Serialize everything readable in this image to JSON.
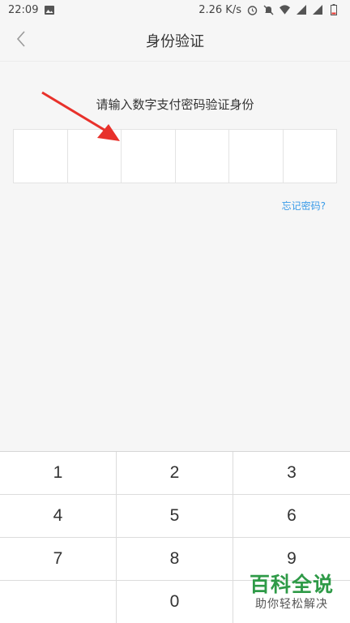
{
  "status_bar": {
    "time": "22:09",
    "speed": "2.26 K/s",
    "icons": [
      "image-icon",
      "alarm-icon",
      "mute-icon",
      "wifi-icon",
      "signal-icon",
      "signal-icon",
      "battery-icon"
    ]
  },
  "header": {
    "title": "身份验证",
    "back_icon": "chevron-left-icon"
  },
  "main": {
    "prompt": "请输入数字支付密码验证身份",
    "pin_length": 6,
    "forgot_link": "忘记密码?"
  },
  "keypad": {
    "keys": [
      "1",
      "2",
      "3",
      "4",
      "5",
      "6",
      "7",
      "8",
      "9",
      "",
      "0",
      ""
    ]
  },
  "watermark": {
    "title": "百科全说",
    "subtitle": "助你轻松解决"
  },
  "colors": {
    "accent_link": "#3a9be8",
    "arrow": "#e8312b",
    "watermark": "#2e9a47"
  }
}
